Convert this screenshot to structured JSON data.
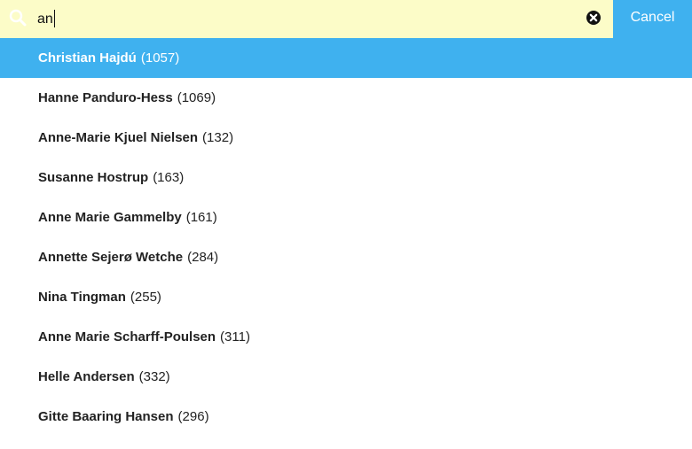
{
  "search": {
    "value": "an",
    "cancel_label": "Cancel"
  },
  "colors": {
    "search_background": "#fcfcc8",
    "accent": "#3fb1ef"
  },
  "icons": {
    "search": "search-icon",
    "clear": "clear-icon"
  },
  "results": [
    {
      "name": "Christian Hajdú",
      "id": "(1057)",
      "selected": true
    },
    {
      "name": "Hanne Panduro-Hess",
      "id": "(1069)"
    },
    {
      "name": "Anne-Marie Kjuel Nielsen",
      "id": "(132)"
    },
    {
      "name": "Susanne Hostrup",
      "id": "(163)"
    },
    {
      "name": "Anne Marie Gammelby",
      "id": "(161)"
    },
    {
      "name": "Annette Sejerø Wetche",
      "id": "(284)"
    },
    {
      "name": "Nina Tingman",
      "id": "(255)"
    },
    {
      "name": "Anne Marie Scharff-Poulsen",
      "id": "(311)"
    },
    {
      "name": "Helle Andersen",
      "id": "(332)"
    },
    {
      "name": "Gitte Baaring Hansen",
      "id": "(296)"
    }
  ]
}
